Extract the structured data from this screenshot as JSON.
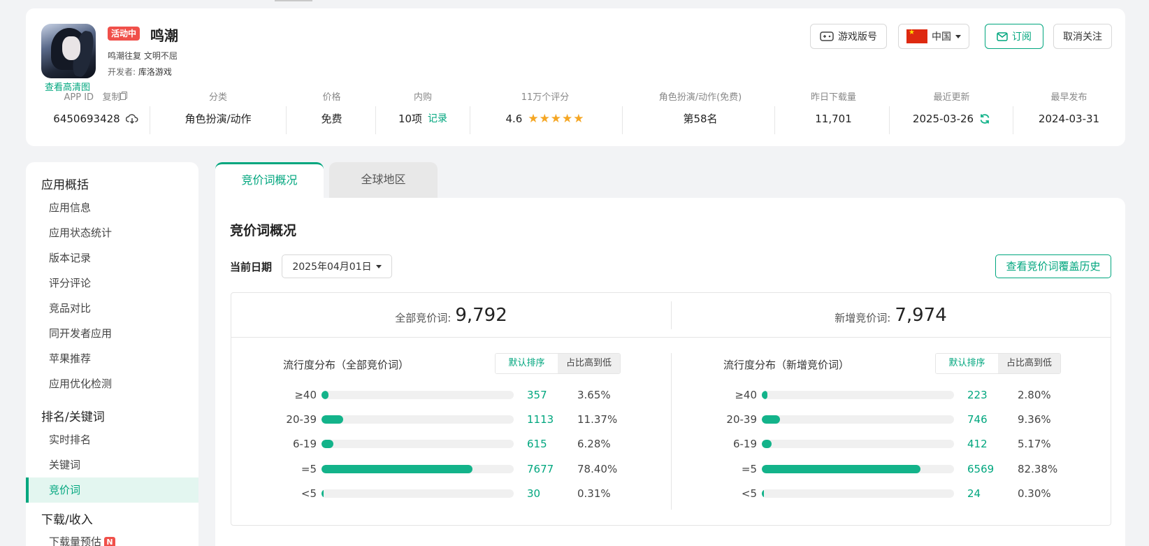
{
  "app": {
    "name": "鸣潮",
    "status_badge": "活动中",
    "subtitle": "鸣潮往复 文明不屈",
    "developer_label": "开发者:",
    "developer": "库洛游戏",
    "hd_link": "查看高清图"
  },
  "header_buttons": {
    "game_version": "游戏版号",
    "region": "中国",
    "subscribe": "订阅",
    "unfollow": "取消关注"
  },
  "metrics": [
    {
      "label": "APP ID",
      "value": "6450693428",
      "extra": "复制"
    },
    {
      "label": "分类",
      "value": "角色扮演/动作"
    },
    {
      "label": "价格",
      "value": "免费"
    },
    {
      "label": "内购",
      "value": "10项",
      "extra": "记录"
    },
    {
      "label": "11万个评分",
      "value": "4.6",
      "rating": 4.6,
      "stars": "★★★★★"
    },
    {
      "label": "角色扮演/动作(免费)",
      "value": "第58名"
    },
    {
      "label": "昨日下载量",
      "value": "11,701"
    },
    {
      "label": "最近更新",
      "value": "2025-03-26"
    },
    {
      "label": "最早发布",
      "value": "2024-03-31"
    }
  ],
  "sidebar": {
    "sections": [
      {
        "title": "应用概括",
        "items": [
          "应用信息",
          "应用状态统计",
          "版本记录",
          "评分评论",
          "竞品对比",
          "同开发者应用",
          "苹果推荐",
          "应用优化检测"
        ]
      },
      {
        "title": "排名/关键词",
        "items": [
          "实时排名",
          "关键词",
          "竞价词"
        ]
      },
      {
        "title": "下载/收入",
        "items": [
          "下载量预估"
        ]
      }
    ],
    "active_item": "竞价词",
    "new_badge": "N"
  },
  "tabs": [
    "竞价词概况",
    "全球地区"
  ],
  "main": {
    "title": "竞价词概况",
    "date_label": "当前日期",
    "date_value": "2025年04月01日",
    "history_button": "查看竞价词覆盖历史",
    "total_label": "全部竞价词:",
    "total_value": "9,792",
    "new_label": "新增竞价词:",
    "new_value": "7,974"
  },
  "distributions": [
    {
      "title": "流行度分布（全部竞价词）",
      "sort_default": "默认排序",
      "sort_ratio": "占比高到低",
      "rows": [
        {
          "label": "≥40",
          "count": "357",
          "pct": "3.65%",
          "ratio": 0.0365
        },
        {
          "label": "20-39",
          "count": "1113",
          "pct": "11.37%",
          "ratio": 0.1137
        },
        {
          "label": "6-19",
          "count": "615",
          "pct": "6.28%",
          "ratio": 0.0628
        },
        {
          "label": "=5",
          "count": "7677",
          "pct": "78.40%",
          "ratio": 0.784
        },
        {
          "label": "<5",
          "count": "30",
          "pct": "0.31%",
          "ratio": 0.0031
        }
      ]
    },
    {
      "title": "流行度分布（新增竞价词）",
      "sort_default": "默认排序",
      "sort_ratio": "占比高到低",
      "rows": [
        {
          "label": "≥40",
          "count": "223",
          "pct": "2.80%",
          "ratio": 0.028
        },
        {
          "label": "20-39",
          "count": "746",
          "pct": "9.36%",
          "ratio": 0.0936
        },
        {
          "label": "6-19",
          "count": "412",
          "pct": "5.17%",
          "ratio": 0.0517
        },
        {
          "label": "=5",
          "count": "6569",
          "pct": "82.38%",
          "ratio": 0.8238
        },
        {
          "label": "<5",
          "count": "24",
          "pct": "0.30%",
          "ratio": 0.003
        }
      ]
    }
  ],
  "colors": {
    "accent": "#00a67e",
    "bar": "#13b38a",
    "badge": "#f0504a"
  }
}
